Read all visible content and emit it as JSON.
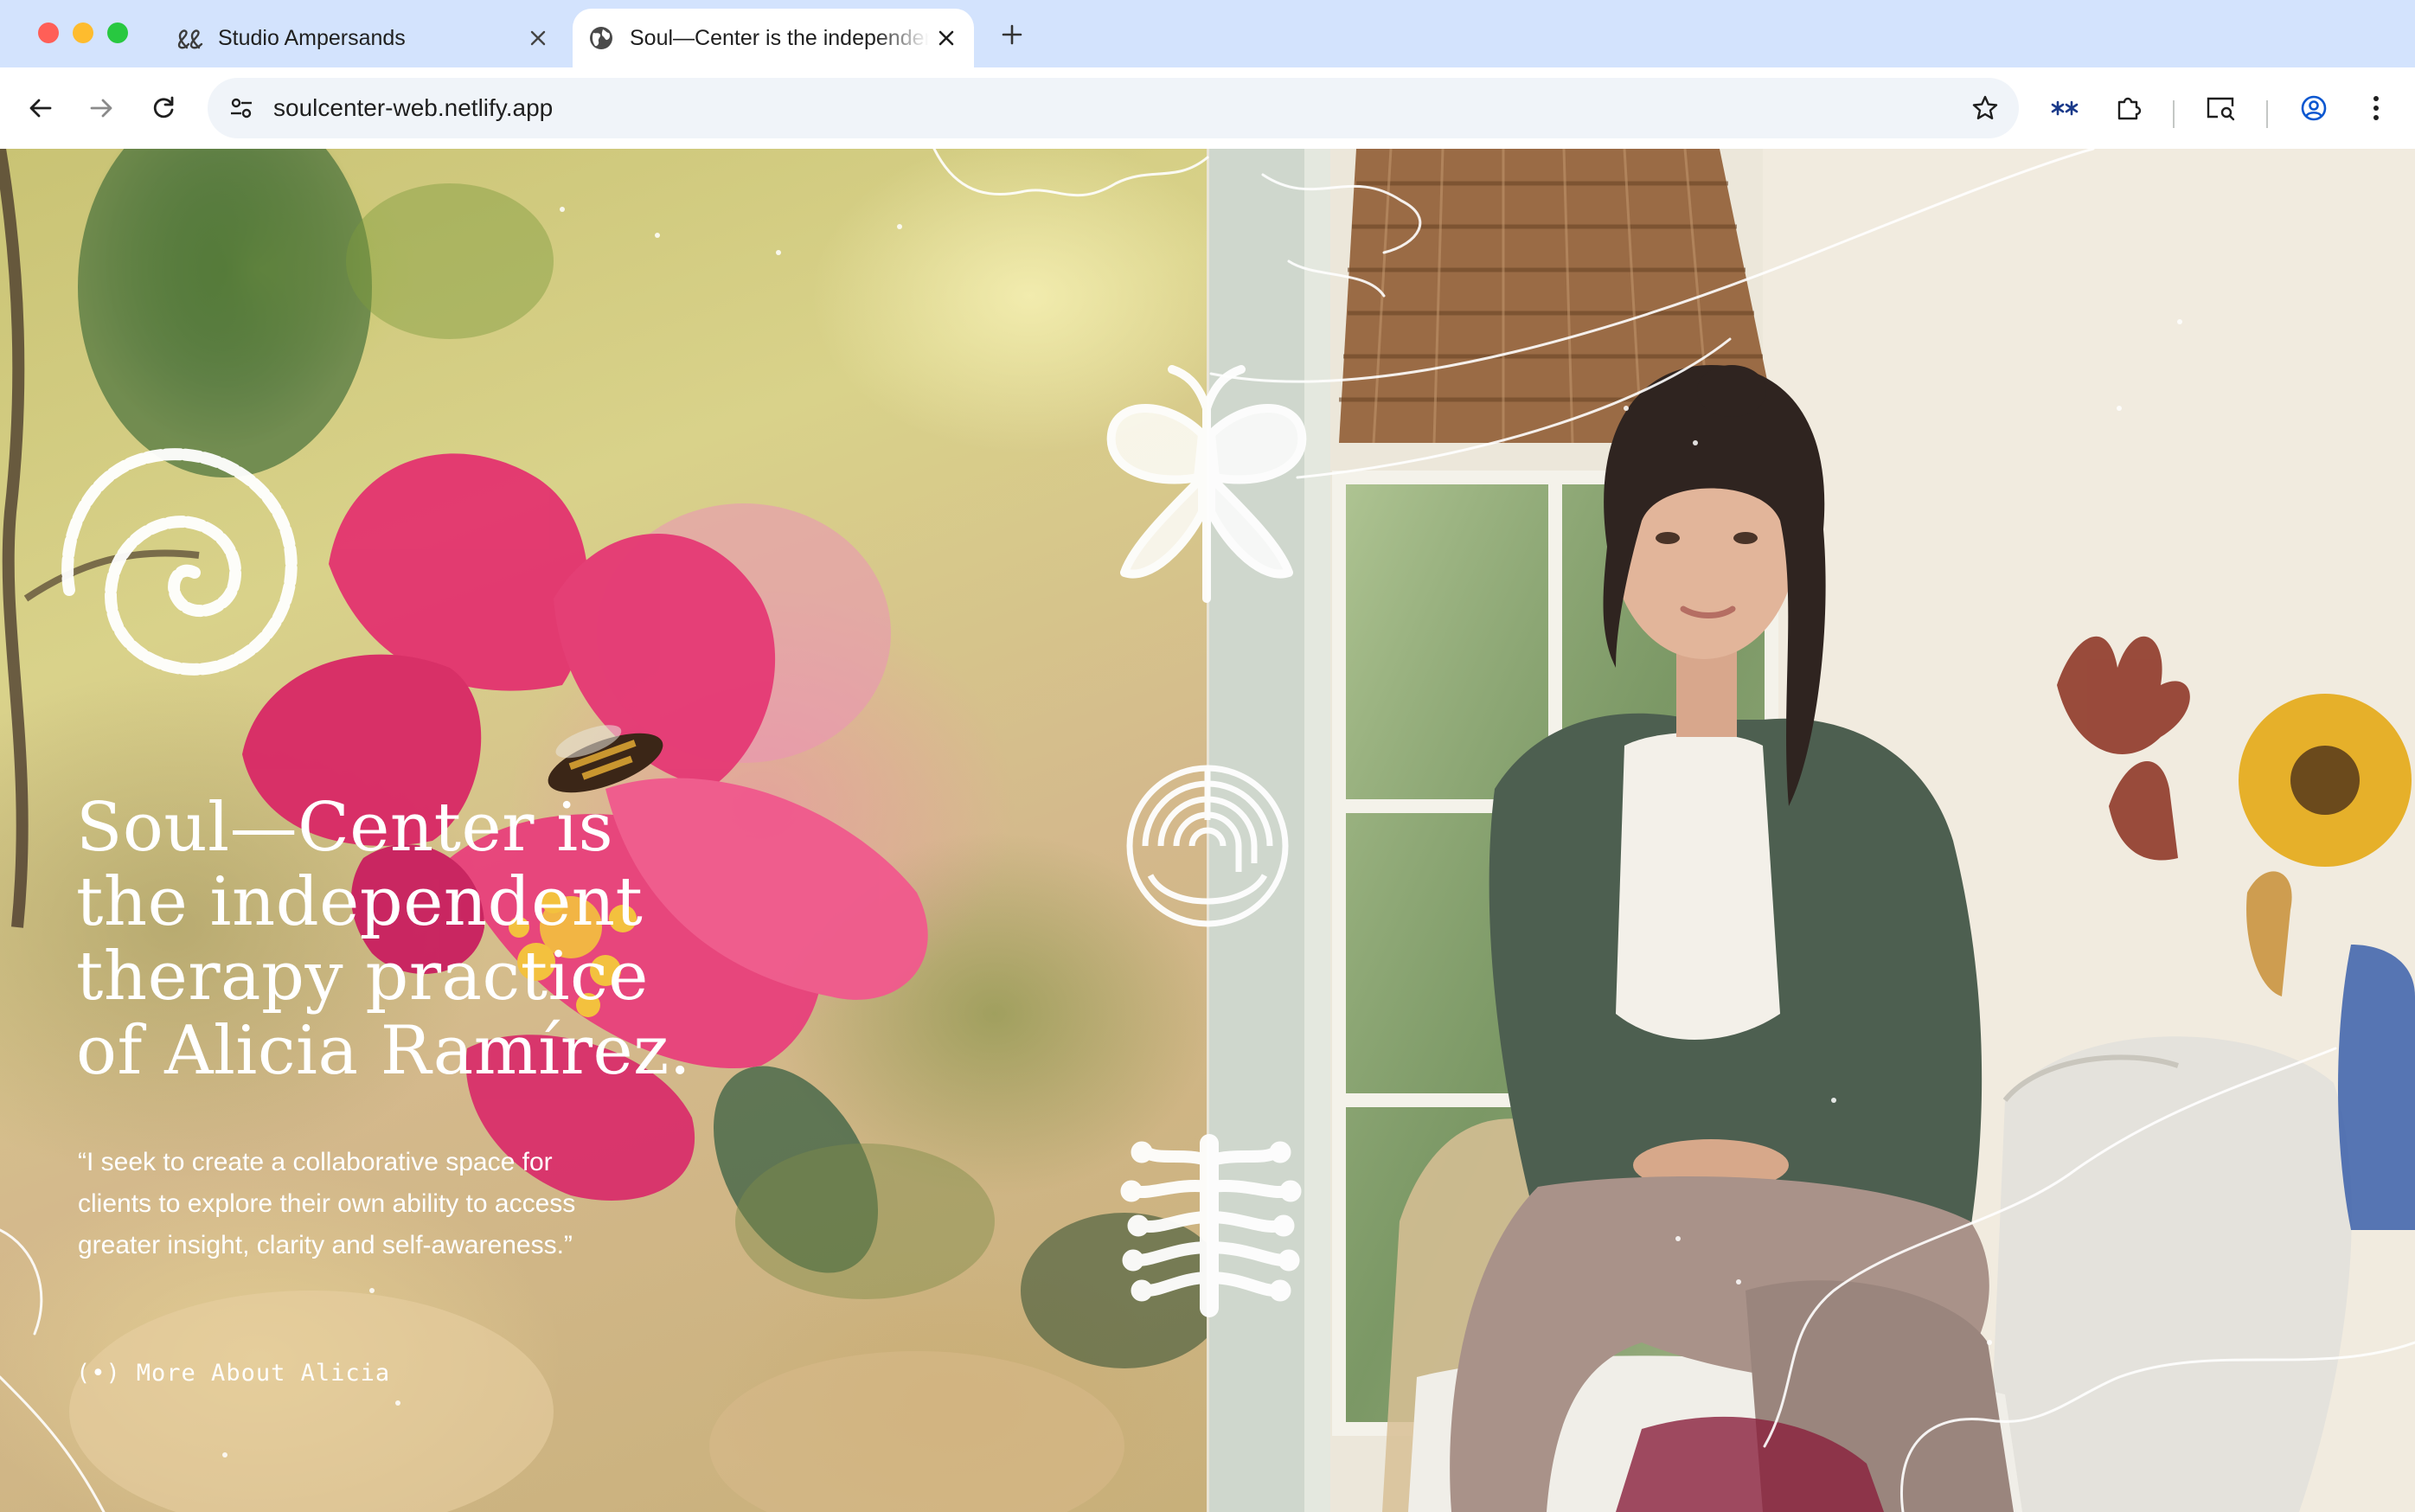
{
  "browser": {
    "tabs": [
      {
        "title": "Studio Ampersands",
        "favicon": "ampersands-logo-icon",
        "active": false
      },
      {
        "title": "Soul—Center is the independent therapy practice of Alicia Ramírez.",
        "favicon": "globe-icon",
        "active": true
      }
    ],
    "url": "soulcenter-web.netlify.app",
    "icons": {
      "back": "arrow-left-icon",
      "forward": "arrow-right-icon",
      "reload": "reload-icon",
      "site_info": "tune-icon",
      "bookmark": "star-icon",
      "extension_1": "asterisks-icon",
      "extensions": "puzzle-icon",
      "cast": "screen-search-icon",
      "profile": "account-circle-icon",
      "menu": "kebab-menu-icon"
    },
    "colors": {
      "tabbar": "#d3e3fd",
      "toolbar": "#ffffff",
      "omnibox": "#f0f4f9"
    }
  },
  "hero": {
    "headline": "Soul—Center is\nthe independent\ntherapy practice\nof Alicia Ramírez.",
    "quote": "“I seek to create a collaborative space for clients to explore their own ability to access greater insight, clarity and self-awareness.”",
    "cta_bullet": "(•)",
    "cta_label": "More About Alicia",
    "text_color": "#ffffff",
    "decorations": [
      "spiral-icon",
      "butterfly-icon",
      "labyrinth-icon",
      "centipede-icon"
    ]
  }
}
